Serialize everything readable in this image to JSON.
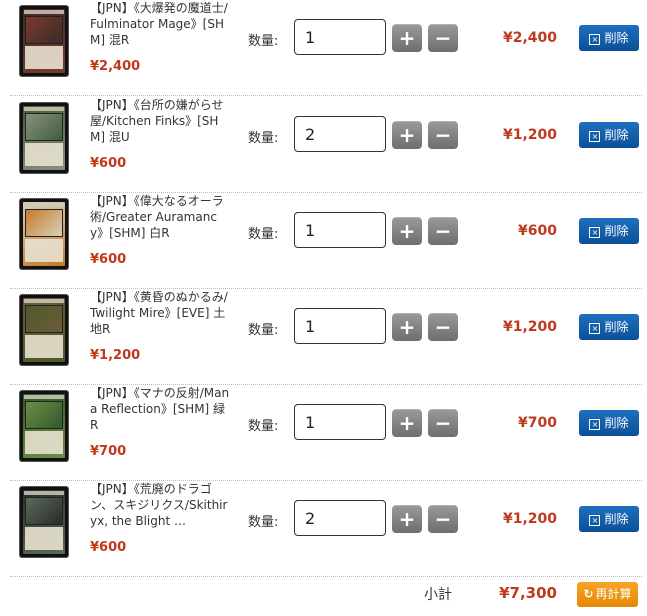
{
  "cart": {
    "items": [
      {
        "name": "【JPN】《大爆発の魔道士/Fulminator Mage》[SHM] 混R",
        "price": "¥2,400",
        "qty_label": "数量:",
        "qty": "1",
        "total": "¥2,400",
        "delete_label": "削除",
        "card_colors": [
          "#3b2a2a",
          "#7a3b2b"
        ]
      },
      {
        "name": "【JPN】《台所の嫌がらせ屋/Kitchen Finks》[SHM] 混U",
        "price": "¥600",
        "qty_label": "数量:",
        "qty": "2",
        "total": "¥1,200",
        "delete_label": "削除",
        "card_colors": [
          "#3f5f3a",
          "#8a8f7f"
        ]
      },
      {
        "name": "【JPN】《偉大なるオーラ術/Greater Auramancy》[SHM] 白R",
        "price": "¥600",
        "qty_label": "数量:",
        "qty": "1",
        "total": "¥600",
        "delete_label": "削除",
        "card_colors": [
          "#d8d0b8",
          "#c47a2e"
        ]
      },
      {
        "name": "【JPN】《黄昏のぬかるみ/Twilight Mire》[EVE] 土地R",
        "price": "¥1,200",
        "qty_label": "数量:",
        "qty": "1",
        "total": "¥1,200",
        "delete_label": "削除",
        "card_colors": [
          "#6d5b3a",
          "#4d5a2a"
        ]
      },
      {
        "name": "【JPN】《マナの反射/Mana Reflection》[SHM] 緑R",
        "price": "¥700",
        "qty_label": "数量:",
        "qty": "1",
        "total": "¥700",
        "delete_label": "削除",
        "card_colors": [
          "#2f5a2c",
          "#6f8c44"
        ]
      },
      {
        "name": "【JPN】《荒廃のドラゴン、スキジリクス/Skithiryx, the Blight …",
        "price": "¥600",
        "qty_label": "数量:",
        "qty": "2",
        "total": "¥1,200",
        "delete_label": "削除",
        "card_colors": [
          "#2a2a2a",
          "#5b6a5a"
        ]
      }
    ],
    "subtotal_label": "小計",
    "subtotal": "¥7,300",
    "recalc_label": "再計算",
    "plus_symbol": "+",
    "minus_symbol": "−"
  },
  "colors": {
    "price": "#c0391b",
    "delete_button": "#0c4f97",
    "recalc_button": "#e58806",
    "qty_button": "#7a7a7a"
  }
}
